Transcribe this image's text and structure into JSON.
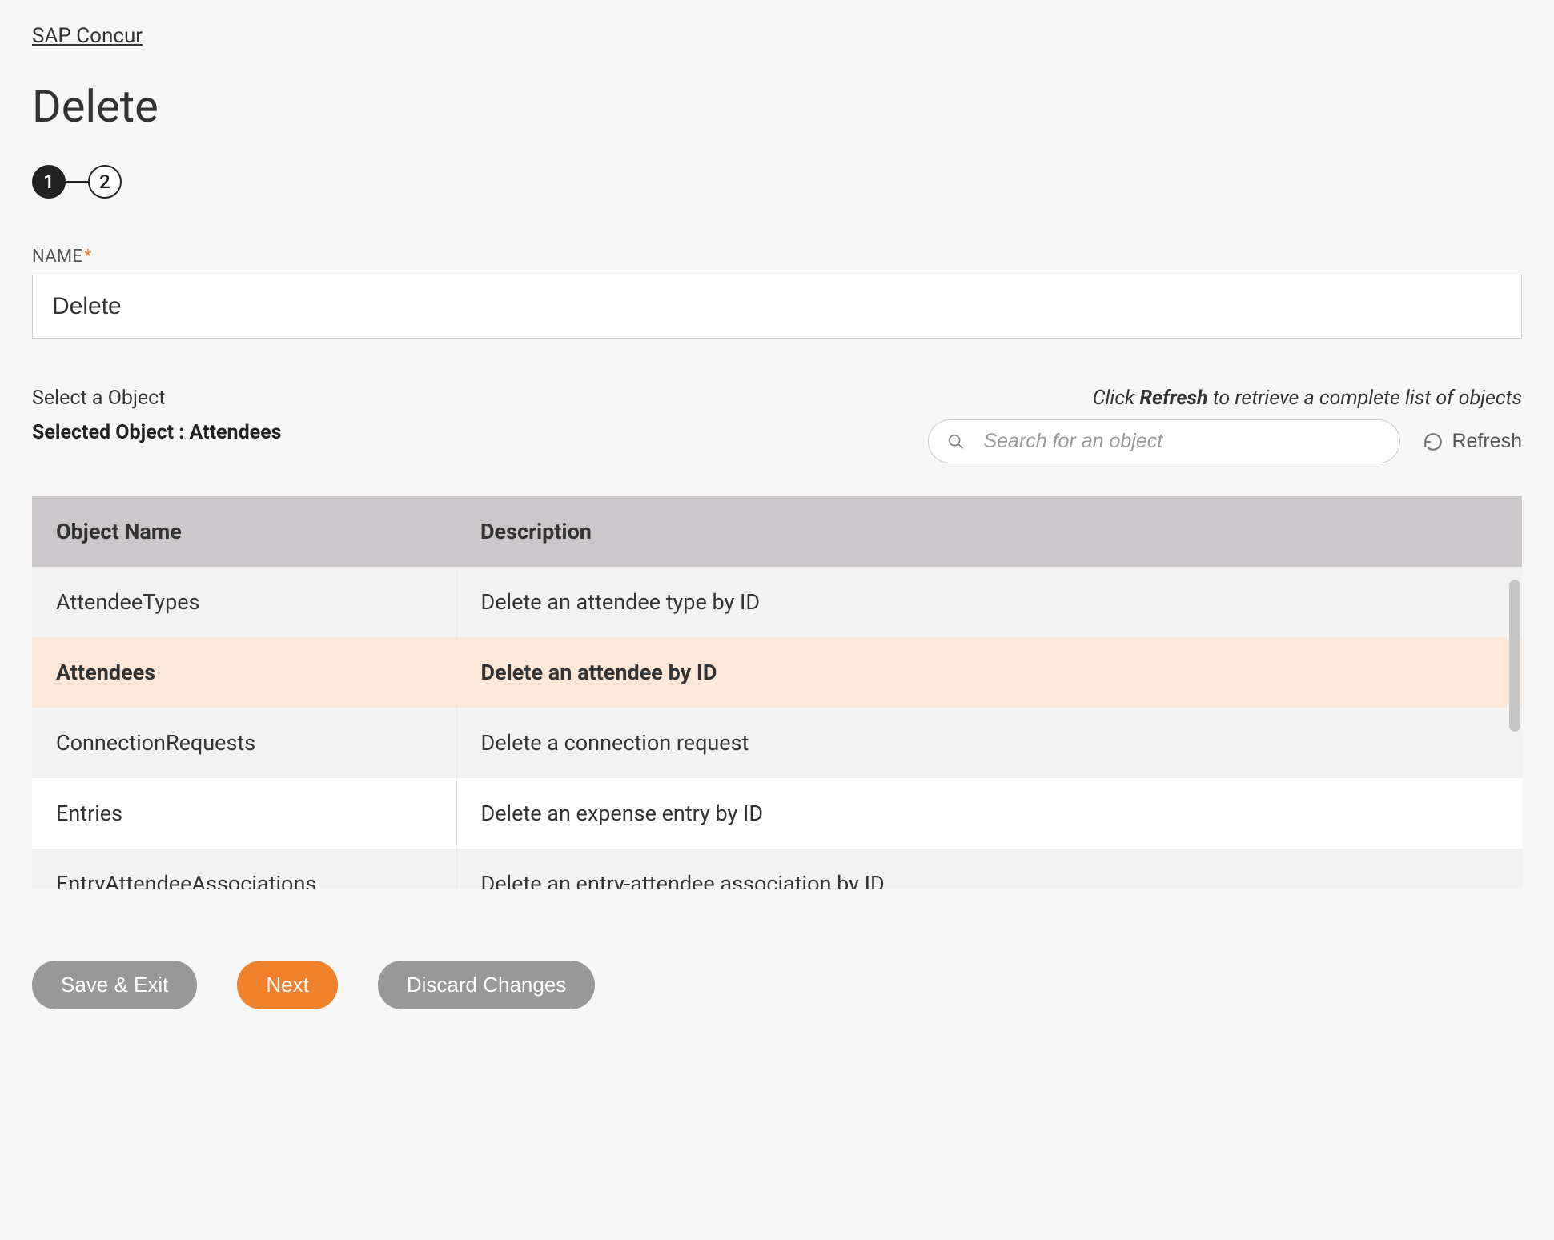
{
  "breadcrumb": "SAP Concur",
  "page_title": "Delete",
  "stepper": {
    "steps": [
      "1",
      "2"
    ],
    "active_index": 0
  },
  "name_field": {
    "label": "NAME",
    "required_marker": "*",
    "value": "Delete"
  },
  "object_section": {
    "select_label": "Select a Object",
    "selected_prefix": "Selected Object : ",
    "selected_value": "Attendees",
    "refresh_hint_pre": "Click ",
    "refresh_hint_bold": "Refresh",
    "refresh_hint_post": " to retrieve a complete list of objects",
    "search_placeholder": "Search for an object",
    "refresh_label": "Refresh"
  },
  "table": {
    "headers": {
      "name": "Object Name",
      "description": "Description"
    },
    "rows": [
      {
        "name": "AttendeeTypes",
        "description": "Delete an attendee type by ID",
        "selected": false
      },
      {
        "name": "Attendees",
        "description": "Delete an attendee by ID",
        "selected": true
      },
      {
        "name": "ConnectionRequests",
        "description": "Delete a connection request",
        "selected": false
      },
      {
        "name": "Entries",
        "description": "Delete an expense entry by ID",
        "selected": false
      },
      {
        "name": "EntryAttendeeAssociations",
        "description": "Delete an entry-attendee association by ID",
        "selected": false
      }
    ]
  },
  "buttons": {
    "save_exit": "Save & Exit",
    "next": "Next",
    "discard": "Discard Changes"
  }
}
